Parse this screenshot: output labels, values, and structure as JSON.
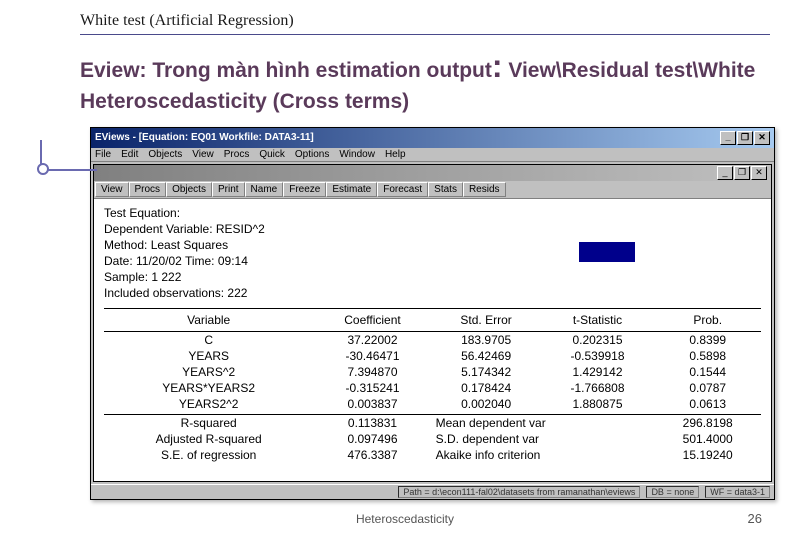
{
  "slide": {
    "title": "White test (Artificial Regression)",
    "subtitle_prefix": "Eview: Trong màn hình estimation output",
    "subtitle_colon": ":",
    "subtitle_suffix": " View\\Residual test\\White Heteroscedasticity (Cross terms)",
    "footer": "Heteroscedasticity",
    "page": "26"
  },
  "eviews": {
    "app_title": "EViews - [Equation: EQ01   Workfile: DATA3-11]",
    "menus": [
      "File",
      "Edit",
      "Objects",
      "View",
      "Procs",
      "Quick",
      "Options",
      "Window",
      "Help"
    ],
    "win_minimize": "_",
    "win_maximize": "❐",
    "win_close": "✕",
    "toolbar": [
      "View",
      "Procs",
      "Objects",
      "Print",
      "Name",
      "Freeze",
      "Estimate",
      "Forecast",
      "Stats",
      "Resids"
    ],
    "info": {
      "l1": "Test Equation:",
      "l2": "Dependent Variable: RESID^2",
      "l3": "Method: Least Squares",
      "l4": "Date: 11/20/02   Time: 09:14",
      "l5": "Sample: 1 222",
      "l6": "Included observations: 222"
    },
    "headers": {
      "var": "Variable",
      "coef": "Coefficient",
      "se": "Std. Error",
      "t": "t-Statistic",
      "p": "Prob."
    },
    "rows": [
      {
        "var": "C",
        "coef": "37.22002",
        "se": "183.9705",
        "t": "0.202315",
        "p": "0.8399"
      },
      {
        "var": "YEARS",
        "coef": "-30.46471",
        "se": "56.42469",
        "t": "-0.539918",
        "p": "0.5898"
      },
      {
        "var": "YEARS^2",
        "coef": "7.394870",
        "se": "5.174342",
        "t": "1.429142",
        "p": "0.1544"
      },
      {
        "var": "YEARS*YEARS2",
        "coef": "-0.315241",
        "se": "0.178424",
        "t": "-1.766808",
        "p": "0.0787"
      },
      {
        "var": "YEARS2^2",
        "coef": "0.003837",
        "se": "0.002040",
        "t": "1.880875",
        "p": "0.0613"
      }
    ],
    "stats": {
      "r2_lbl": "R-squared",
      "r2": "0.113831",
      "mdv_lbl": "Mean dependent var",
      "mdv": "296.8198",
      "ar2_lbl": "Adjusted R-squared",
      "ar2": "0.097496",
      "sdv_lbl": "S.D. dependent var",
      "sdv": "501.4000",
      "se_lbl": "S.E. of regression",
      "se": "476.3387",
      "aic_lbl": "Akaike info criterion",
      "aic": "15.19240"
    },
    "status": {
      "path": "Path = d:\\econ111-fal02\\datasets from ramanathan\\eviews",
      "db": "DB = none",
      "wf": "WF = data3-1"
    }
  }
}
